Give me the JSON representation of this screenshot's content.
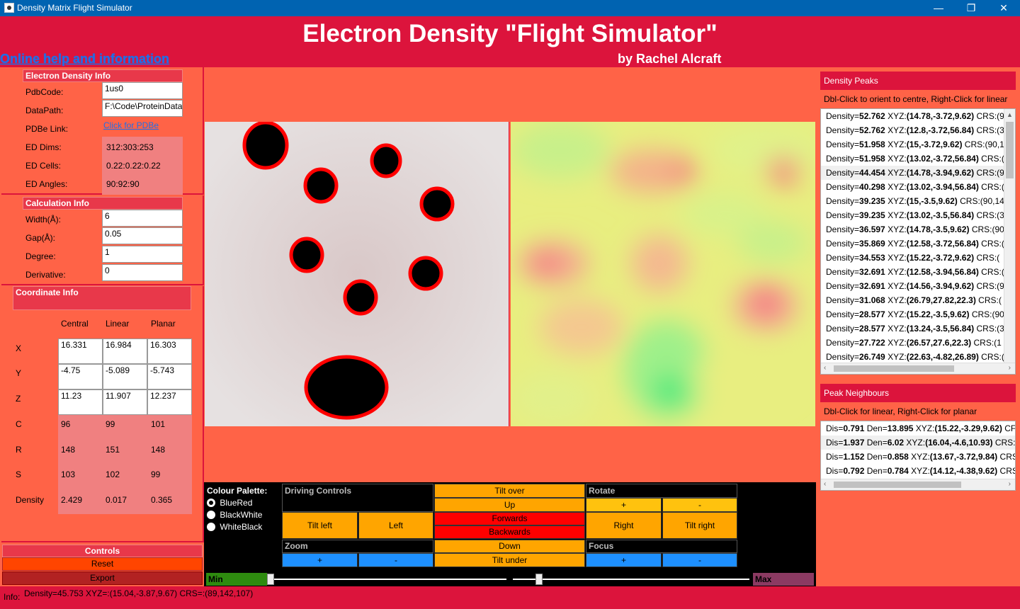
{
  "window": {
    "title": "Density Matrix Flight Simulator",
    "minimize": "—",
    "restore": "❐",
    "close": "✕",
    "icon": "app-icon"
  },
  "header": {
    "title": "Electron Density \"Flight Simulator\"",
    "byline": "by Rachel Alcraft",
    "help_link": "Online help and information"
  },
  "electron_density_info": {
    "heading": "Electron Density Info",
    "pdbcode_label": "PdbCode:",
    "pdbcode_value": "1us0",
    "datapath_label": "DataPath:",
    "datapath_value": "F:\\Code\\ProteinData",
    "pdbe_label": "PDBe Link:",
    "pdbe_link": "Click for PDBe",
    "dims_label": "ED Dims:",
    "dims_value": "312:303:253",
    "cells_label": "ED Cells:",
    "cells_value": "0.22:0.22:0.22",
    "angles_label": "ED Angles:",
    "angles_value": "90:92:90"
  },
  "calculation_info": {
    "heading": "Calculation Info",
    "width_label": "Width(Å):",
    "width_value": "6",
    "gap_label": "Gap(Å):",
    "gap_value": "0.05",
    "degree_label": "Degree:",
    "degree_value": "1",
    "derivative_label": "Derivative:",
    "derivative_value": "0"
  },
  "coordinate_info": {
    "heading": "Coordinate Info",
    "col_central": "Central",
    "col_linear": "Linear",
    "col_planar": "Planar",
    "rows": {
      "X": {
        "label": "X",
        "central": "16.331",
        "linear": "16.984",
        "planar": "16.303"
      },
      "Y": {
        "label": "Y",
        "central": "-4.75",
        "linear": "-5.089",
        "planar": "-5.743"
      },
      "Z": {
        "label": "Z",
        "central": "11.23",
        "linear": "11.907",
        "planar": "12.237"
      },
      "C": {
        "label": "C",
        "central": "96",
        "linear": "99",
        "planar": "101"
      },
      "R": {
        "label": "R",
        "central": "148",
        "linear": "151",
        "planar": "148"
      },
      "S": {
        "label": "S",
        "central": "103",
        "linear": "102",
        "planar": "99"
      },
      "D": {
        "label": "Density",
        "central": "2.429",
        "linear": "0.017",
        "planar": "0.365"
      }
    }
  },
  "controls": {
    "heading": "Controls",
    "reset": "Reset",
    "export": "Export"
  },
  "palette": {
    "label": "Colour Palette:",
    "options": [
      "BlueRed",
      "BlackWhite",
      "WhiteBlack"
    ],
    "selected": "BlueRed"
  },
  "driving": {
    "driving_heading": "Driving Controls",
    "tilt_over": "Tilt over",
    "rotate_heading": "Rotate",
    "up": "Up",
    "rotate_plus": "+",
    "rotate_minus": "-",
    "tilt_left": "Tilt left",
    "left": "Left",
    "forwards": "Forwards",
    "backwards": "Backwards",
    "right": "Right",
    "tilt_right": "Tilt right",
    "zoom_heading": "Zoom",
    "down": "Down",
    "focus_heading": "Focus",
    "zoom_plus": "+",
    "zoom_minus": "-",
    "tilt_under": "Tilt under",
    "focus_plus": "+",
    "focus_minus": "-",
    "min_label": "Min",
    "max_label": "Max"
  },
  "density_peaks": {
    "heading": "Density Peaks",
    "hint": "Dbl-Click to orient to centre, Right-Click for linear",
    "items": [
      {
        "density": "52.762",
        "xyz": "(14.78,-3.72,9.62)",
        "crs": "(9"
      },
      {
        "density": "52.762",
        "xyz": "(12.8,-3.72,56.84)",
        "crs": "(3"
      },
      {
        "density": "51.958",
        "xyz": "(15,-3.72,9.62)",
        "crs": "(90,1"
      },
      {
        "density": "51.958",
        "xyz": "(13.02,-3.72,56.84)",
        "crs": "("
      },
      {
        "density": "44.454",
        "xyz": "(14.78,-3.94,9.62)",
        "crs": "(9"
      },
      {
        "density": "40.298",
        "xyz": "(13.02,-3.94,56.84)",
        "crs": "("
      },
      {
        "density": "39.235",
        "xyz": "(15,-3.5,9.62)",
        "crs": "(90,14"
      },
      {
        "density": "39.235",
        "xyz": "(13.02,-3.5,56.84)",
        "crs": "(3"
      },
      {
        "density": "36.597",
        "xyz": "(14.78,-3.5,9.62)",
        "crs": "(90"
      },
      {
        "density": "35.869",
        "xyz": "(12.58,-3.72,56.84)",
        "crs": "("
      },
      {
        "density": "34.553",
        "xyz": "(15.22,-3.72,9.62)",
        "crs": "("
      },
      {
        "density": "32.691",
        "xyz": "(12.58,-3.94,56.84)",
        "crs": "("
      },
      {
        "density": "32.691",
        "xyz": "(14.56,-3.94,9.62)",
        "crs": "(9"
      },
      {
        "density": "31.068",
        "xyz": "(26.79,27.82,22.3)",
        "crs": "("
      },
      {
        "density": "28.577",
        "xyz": "(15.22,-3.5,9.62)",
        "crs": "(90"
      },
      {
        "density": "28.577",
        "xyz": "(13.24,-3.5,56.84)",
        "crs": "(3"
      },
      {
        "density": "27.722",
        "xyz": "(26.57,27.6,22.3)",
        "crs": "(1"
      },
      {
        "density": "26.749",
        "xyz": "(22.63,-4.82,26.89)",
        "crs": "("
      }
    ]
  },
  "peak_neighbours": {
    "heading": "Peak Neighbours",
    "hint": "Dbl-Click for linear, Right-Click for planar",
    "items": [
      {
        "dis": "0.791",
        "den": "13.895",
        "xyz": "(15.22,-3.29,9.62)",
        "tail": "CF"
      },
      {
        "dis": "1.937",
        "den": "6.02",
        "xyz": "(16.04,-4.6,10.93)",
        "tail": "CRS:("
      },
      {
        "dis": "1.152",
        "den": "0.858",
        "xyz": "(13.67,-3.72,9.84)",
        "tail": "CRS"
      },
      {
        "dis": "0.792",
        "den": "0.784",
        "xyz": "(14.12,-4.38,9.62)",
        "tail": "CRS"
      }
    ]
  },
  "status": {
    "label": "Info:",
    "text": "Density=45.753 XYZ=:(15.04,-3.87,9.67) CRS=:(89,142,107)"
  },
  "colors": {
    "background": "#dc143c",
    "panel": "#ff6347",
    "titlebar": "#0063b1"
  }
}
